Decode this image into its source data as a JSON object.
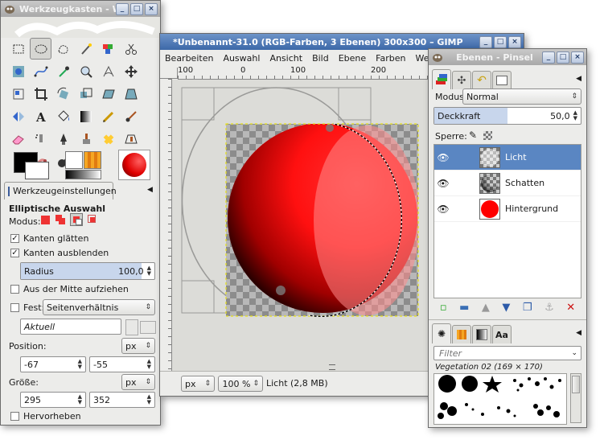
{
  "colors": {
    "accent": "#5a86c2",
    "titlebar_active": "#3c68a8",
    "selection_ant": "#e5e01a",
    "sphere_red": "#ff1010",
    "checker_dark": "#8c8c8c",
    "checker_light": "#b8b8b8"
  },
  "toolbox": {
    "title": "Werkzeugkasten - We",
    "tools": [
      "rect-select-icon",
      "ellipse-select-icon",
      "free-select-icon",
      "fuzzy-select-icon",
      "color-select-icon",
      "scissors-icon",
      "foreground-select-icon",
      "paths-icon",
      "color-picker-icon",
      "zoom-icon",
      "measure-icon",
      "move-icon",
      "align-icon",
      "crop-icon",
      "rotate-icon",
      "scale-icon",
      "shear-icon",
      "perspective-icon",
      "flip-icon",
      "text-icon",
      "bucket-fill-icon",
      "blend-icon",
      "pencil-icon",
      "paintbrush-icon",
      "eraser-icon",
      "airbrush-icon",
      "ink-icon",
      "clone-icon",
      "heal-icon",
      "perspective-clone-icon",
      "blur-icon",
      "smudge-icon",
      "dodge-burn-icon"
    ],
    "options_tab": "Werkzeugeinstellungen",
    "options_title": "Elliptische Auswahl",
    "modus_label": "Modus:",
    "antialias": "Kanten glätten",
    "feather": "Kanten ausblenden",
    "radius_label": "Radius",
    "radius_value": "100,0",
    "expand_center": "Aus der Mitte aufziehen",
    "fixed_label": "Fest:",
    "fixed_value": "Seitenverhältnis",
    "ratio_value": "Aktuell",
    "position_label": "Position:",
    "position_unit": "px",
    "pos_x": "-67",
    "pos_y": "-55",
    "size_label": "Größe:",
    "size_unit": "px",
    "size_w": "295",
    "size_h": "352",
    "highlight": "Hervorheben"
  },
  "image_window": {
    "title": "*Unbenannt-31.0 (RGB-Farben, 3 Ebenen) 300x300 – GIMP",
    "menu": [
      "Bearbeiten",
      "Auswahl",
      "Ansicht",
      "Bild",
      "Ebene",
      "Farben",
      "Werkzeu"
    ],
    "ruler_ticks": [
      "100",
      "0",
      "100",
      "200"
    ],
    "unit": "px",
    "zoom": "100 %",
    "status": "Licht (2,8 MB)"
  },
  "layers": {
    "title": "Ebenen - Pinsel",
    "mode_label": "Modus:",
    "mode_value": "Normal",
    "opacity_label": "Deckkraft",
    "opacity_value": "50,0",
    "opacity_level": 0.5,
    "lock_label": "Sperre:",
    "items": [
      {
        "name": "Licht",
        "selected": true
      },
      {
        "name": "Schatten",
        "selected": false
      },
      {
        "name": "Hintergrund",
        "selected": false
      }
    ],
    "filter_placeholder": "Filter",
    "brush_name": "Vegetation 02 (169 × 170)"
  }
}
